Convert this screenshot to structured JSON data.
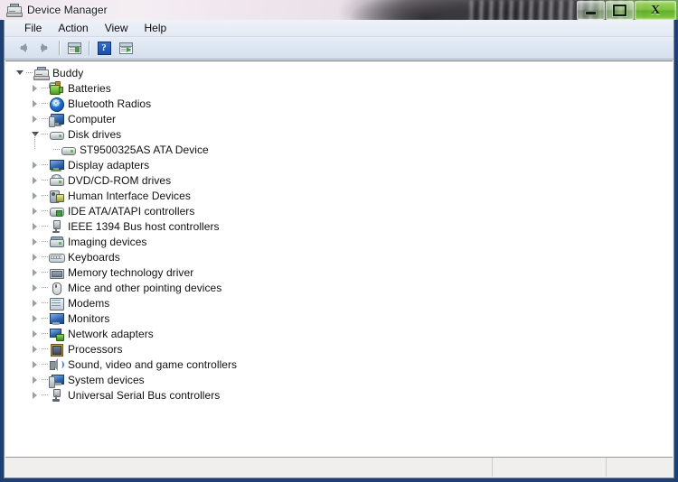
{
  "window": {
    "title": "Device Manager",
    "title_icon": "device-manager-icon",
    "controls": {
      "minimize": "Minimize",
      "maximize": "Maximize",
      "close": "Close",
      "close_glyph": "X"
    }
  },
  "menu": {
    "items": [
      {
        "label": "File"
      },
      {
        "label": "Action"
      },
      {
        "label": "View"
      },
      {
        "label": "Help"
      }
    ]
  },
  "toolbar": {
    "buttons": [
      {
        "name": "back-button",
        "icon": "back-arrow-icon",
        "tooltip": "Back"
      },
      {
        "name": "forward-button",
        "icon": "forward-arrow-icon",
        "tooltip": "Forward"
      },
      {
        "name": "properties-button",
        "icon": "properties-window-icon",
        "tooltip": "Properties"
      },
      {
        "name": "help-button",
        "icon": "help-question-icon",
        "tooltip": "Help",
        "glyph": "?"
      },
      {
        "name": "scan-hardware-button",
        "icon": "scan-hardware-icon",
        "tooltip": "Scan for hardware changes"
      }
    ]
  },
  "tree": {
    "root": {
      "label": "Buddy",
      "icon": "computer-root-icon",
      "expanded": true
    },
    "nodes": [
      {
        "label": "Batteries",
        "icon": "battery-icon",
        "expanded": false,
        "indent": 1
      },
      {
        "label": "Bluetooth Radios",
        "icon": "bluetooth-icon",
        "expanded": false,
        "indent": 1
      },
      {
        "label": "Computer",
        "icon": "computer-icon",
        "expanded": false,
        "indent": 1
      },
      {
        "label": "Disk drives",
        "icon": "disk-drive-icon",
        "expanded": true,
        "indent": 1
      },
      {
        "label": "ST9500325AS ATA Device",
        "icon": "disk-drive-icon",
        "expanded": null,
        "indent": 2,
        "child": true
      },
      {
        "label": "Display adapters",
        "icon": "display-adapter-icon",
        "expanded": false,
        "indent": 1
      },
      {
        "label": "DVD/CD-ROM drives",
        "icon": "dvd-drive-icon",
        "expanded": false,
        "indent": 1
      },
      {
        "label": "Human Interface Devices",
        "icon": "human-interface-device-icon",
        "expanded": false,
        "indent": 1
      },
      {
        "label": "IDE ATA/ATAPI controllers",
        "icon": "ide-controller-icon",
        "expanded": false,
        "indent": 1
      },
      {
        "label": "IEEE 1394 Bus host controllers",
        "icon": "ieee1394-icon",
        "expanded": false,
        "indent": 1
      },
      {
        "label": "Imaging devices",
        "icon": "imaging-device-icon",
        "expanded": false,
        "indent": 1
      },
      {
        "label": "Keyboards",
        "icon": "keyboard-icon",
        "expanded": false,
        "indent": 1
      },
      {
        "label": "Memory technology driver",
        "icon": "memory-technology-icon",
        "expanded": false,
        "indent": 1
      },
      {
        "label": "Mice and other pointing devices",
        "icon": "mouse-icon",
        "expanded": false,
        "indent": 1
      },
      {
        "label": "Modems",
        "icon": "modem-icon",
        "expanded": false,
        "indent": 1
      },
      {
        "label": "Monitors",
        "icon": "monitor-icon",
        "expanded": false,
        "indent": 1
      },
      {
        "label": "Network adapters",
        "icon": "network-adapter-icon",
        "expanded": false,
        "indent": 1
      },
      {
        "label": "Processors",
        "icon": "processor-icon",
        "expanded": false,
        "indent": 1
      },
      {
        "label": "Sound, video and game controllers",
        "icon": "sound-controller-icon",
        "expanded": false,
        "indent": 1
      },
      {
        "label": "System devices",
        "icon": "system-device-icon",
        "expanded": false,
        "indent": 1
      },
      {
        "label": "Universal Serial Bus controllers",
        "icon": "usb-controller-icon",
        "expanded": false,
        "indent": 1
      }
    ]
  },
  "statusbar": {
    "cells": [
      "",
      "",
      ""
    ]
  },
  "colors": {
    "window_border": "#1f3f73",
    "titlebar_close_green": "#7bcd37",
    "content_background": "#ffffff",
    "toolbar_background": "#dde5f1",
    "statusbar_background": "#f0efee",
    "help_icon_blue": "#1b4fa8",
    "tree_text": "#111111"
  }
}
